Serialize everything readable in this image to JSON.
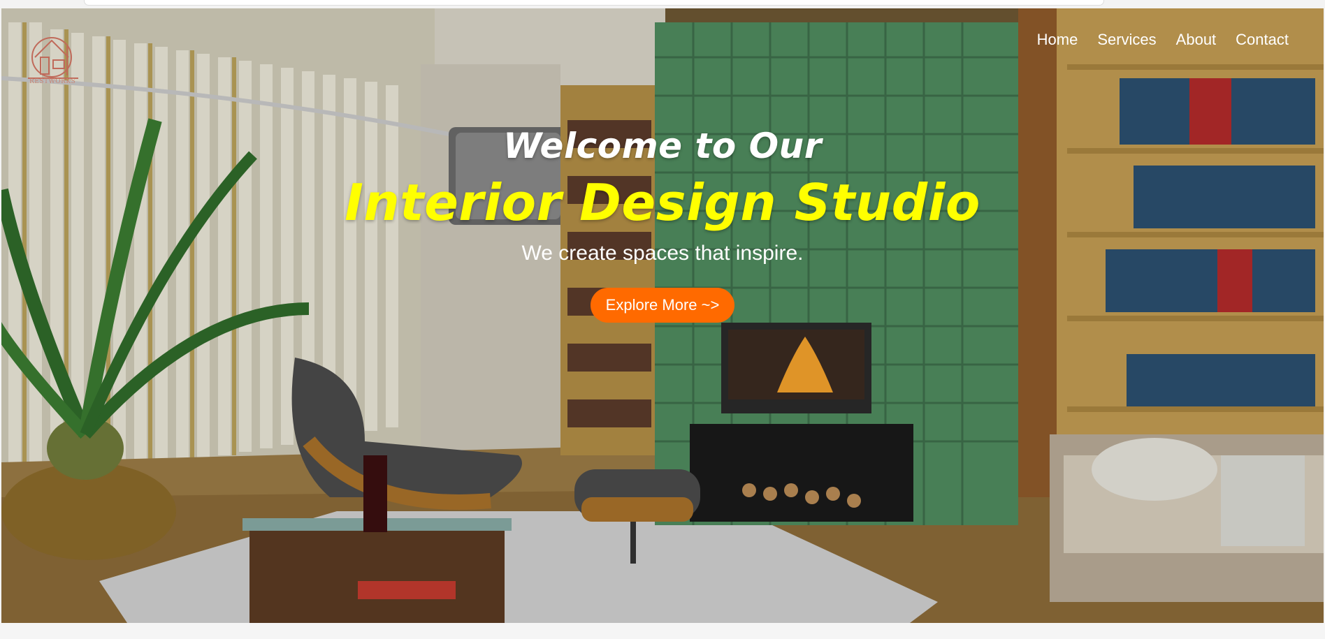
{
  "logo": {
    "text": "RESTWORKS"
  },
  "nav": {
    "items": [
      {
        "label": "Home"
      },
      {
        "label": "Services"
      },
      {
        "label": "About"
      },
      {
        "label": "Contact"
      }
    ]
  },
  "hero": {
    "welcome": "Welcome to Our",
    "studio": "Interior Design Studio",
    "subtitle": "We create spaces that inspire.",
    "cta_label": "Explore More ~>"
  },
  "colors": {
    "accent_yellow": "#ffff00",
    "cta_orange": "#ff6a00",
    "nav_text": "#ffffff"
  },
  "icons": {
    "logo": "house-interior-logo-icon"
  }
}
